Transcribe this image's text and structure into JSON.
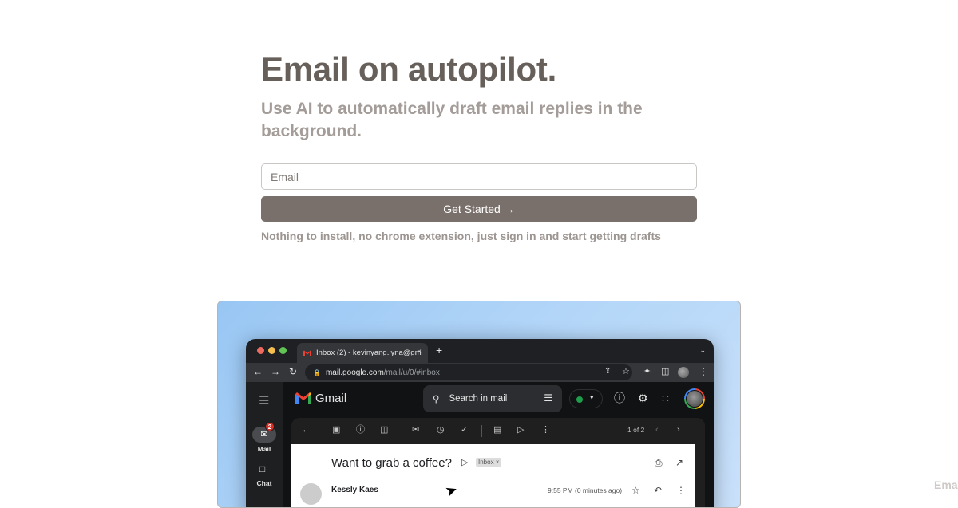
{
  "hero": {
    "title": "Email on autopilot.",
    "subtitle": "Use AI to automatically draft email replies in the background.",
    "email_placeholder": "Email",
    "email_value": "",
    "cta_label": "Get Started →",
    "note": "Nothing to install, no chrome extension, just sign in and start getting drafts"
  },
  "colors": {
    "title": "#675f5a",
    "subtitle": "#a39c98",
    "cta_bg": "#7a706b",
    "demo_bg": "#b3d6f8"
  },
  "demo": {
    "browser": {
      "tab_title": "Inbox (2) - kevinyang.lyna@gm",
      "tab_close": "×",
      "new_tab": "+",
      "url_host": "mail.google.com",
      "url_path": "/mail/u/0/#inbox",
      "icons": [
        "back-icon",
        "forward-icon",
        "reload-icon",
        "lock-icon",
        "share-icon",
        "bookmark-star-icon",
        "extensions-icon",
        "sidepanel-icon",
        "profile-avatar",
        "more-icon"
      ]
    },
    "gmail": {
      "logo_text": "Gmail",
      "search_placeholder": "Search in mail",
      "nav": [
        {
          "label": "Mail",
          "badge": "2"
        },
        {
          "label": "Chat"
        }
      ],
      "pager": "1 of 2",
      "subject": "Want to grab a coffee?",
      "label_chip": "Inbox ×",
      "sender": "Kessly Kaes",
      "time": "9:55 PM (0 minutes ago)"
    }
  },
  "edge_text": "Ema"
}
